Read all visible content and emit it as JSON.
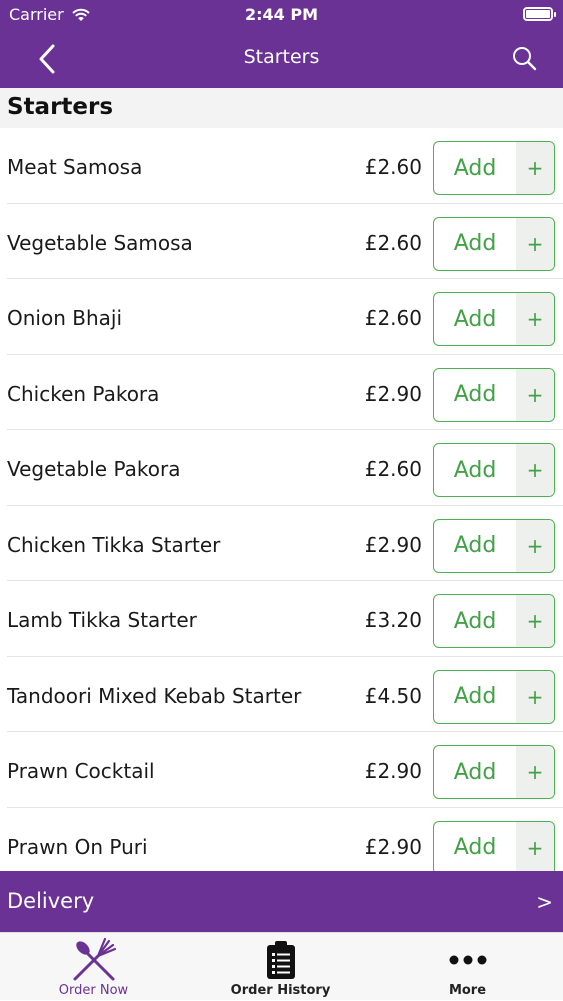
{
  "status_bar": {
    "carrier": "Carrier",
    "time": "2:44 PM"
  },
  "nav": {
    "title": "Starters"
  },
  "section": {
    "title": "Starters"
  },
  "add_label": "Add",
  "plus_label": "+",
  "items": [
    {
      "name": "Meat Samosa",
      "price": "£2.60"
    },
    {
      "name": "Vegetable Samosa",
      "price": "£2.60"
    },
    {
      "name": "Onion Bhaji",
      "price": "£2.60"
    },
    {
      "name": "Chicken Pakora",
      "price": "£2.90"
    },
    {
      "name": "Vegetable Pakora",
      "price": "£2.60"
    },
    {
      "name": "Chicken Tikka Starter",
      "price": "£2.90"
    },
    {
      "name": "Lamb Tikka Starter",
      "price": "£3.20"
    },
    {
      "name": "Tandoori Mixed Kebab Starter",
      "price": "£4.50"
    },
    {
      "name": "Prawn Cocktail",
      "price": "£2.90"
    },
    {
      "name": "Prawn On Puri",
      "price": "£2.90"
    }
  ],
  "delivery": {
    "label": "Delivery",
    "arrow": ">"
  },
  "tabs": [
    {
      "label": "Order Now",
      "icon": "fork-knife-icon",
      "active": true
    },
    {
      "label": "Order History",
      "icon": "clipboard-list-icon",
      "active": false
    },
    {
      "label": "More",
      "icon": "more-dots-icon",
      "active": false
    }
  ],
  "colors": {
    "brand": "#6a3295",
    "add_green": "#43a047",
    "border_green": "#4caf50"
  }
}
